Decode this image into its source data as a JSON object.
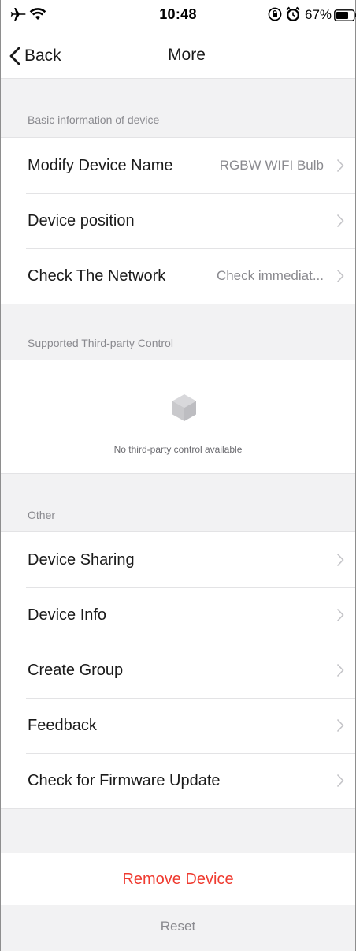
{
  "status_bar": {
    "time": "10:48",
    "battery_percent": "67%",
    "icons": [
      "airplane-icon",
      "wifi-icon",
      "rotation-lock-icon",
      "alarm-icon",
      "battery-icon"
    ]
  },
  "nav": {
    "back_label": "Back",
    "title": "More"
  },
  "sections": {
    "basic": {
      "header": "Basic information of device",
      "rows": [
        {
          "label": "Modify Device Name",
          "value": "RGBW WIFI Bulb"
        },
        {
          "label": "Device position",
          "value": ""
        },
        {
          "label": "Check The Network",
          "value": "Check immediat..."
        }
      ]
    },
    "third_party": {
      "header": "Supported Third-party Control",
      "empty_text": "No third-party control available"
    },
    "other": {
      "header": "Other",
      "rows": [
        {
          "label": "Device Sharing"
        },
        {
          "label": "Device Info"
        },
        {
          "label": "Create Group"
        },
        {
          "label": "Feedback"
        },
        {
          "label": "Check for Firmware Update"
        }
      ]
    }
  },
  "actions": {
    "remove_label": "Remove Device",
    "reset_label": "Reset"
  },
  "colors": {
    "background": "#f2f2f3",
    "destructive": "#ef3b30",
    "secondary_text": "#8a8a8f"
  }
}
